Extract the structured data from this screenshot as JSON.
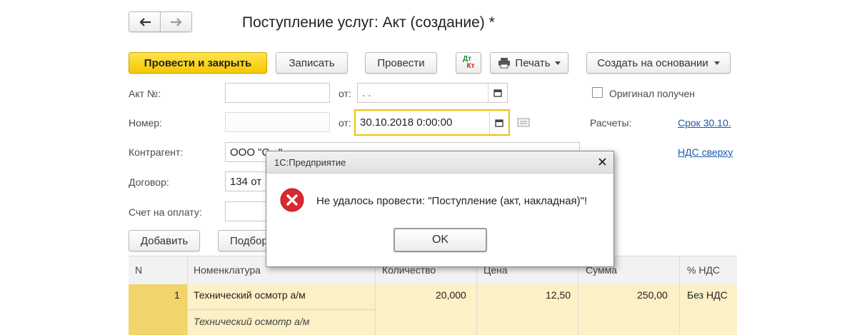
{
  "nav": {
    "back_icon": "arrow-left-icon",
    "forward_icon": "arrow-right-icon"
  },
  "window_title": "Поступление услуг: Акт (создание) *",
  "toolbar": {
    "post_close": "Провести и закрыть",
    "save": "Записать",
    "post": "Провести",
    "dtkt_top": "Дт",
    "dtkt_bottom": "Кт",
    "print": "Печать",
    "create_based": "Создать на основании"
  },
  "form": {
    "act_label": "Акт №:",
    "act_from_label": "от:",
    "act_date_value": " .  .",
    "original_label": "Оригинал получен",
    "number_label": "Номер:",
    "number_from_label": "от:",
    "number_date_value": "30.10.2018  0:00:00",
    "payments_label": "Расчеты:",
    "payments_link": "Срок 30.10.",
    "counterparty_label": "Контрагент:",
    "counterparty_value": "ООО \"С...\"",
    "vat_link": "НДС сверху",
    "contract_label": "Договор:",
    "contract_value": "134 от",
    "invoice_label": "Счет на оплату:"
  },
  "table_toolbar": {
    "add": "Добавить",
    "select": "Подбор"
  },
  "table": {
    "columns": [
      "N",
      "Номенклатура",
      "Количество",
      "Цена",
      "Сумма",
      "% НДС"
    ],
    "rows": [
      {
        "n": "1",
        "item": "Технический осмотр а/м",
        "item_desc": "Технический осмотр а/м",
        "qty": "20,000",
        "price": "12,50",
        "sum": "250,00",
        "vat": "Без НДС"
      }
    ]
  },
  "dialog": {
    "title": "1С:Предприятие",
    "message": "Не удалось провести: \"Поступление (акт, накладная)\"!",
    "ok": "OK",
    "colors": {
      "error": "#d9282f"
    }
  },
  "colors": {
    "accent_yellow": "#f5c800",
    "link": "#1b5aa8",
    "row_highlight": "#fbf0c6"
  }
}
